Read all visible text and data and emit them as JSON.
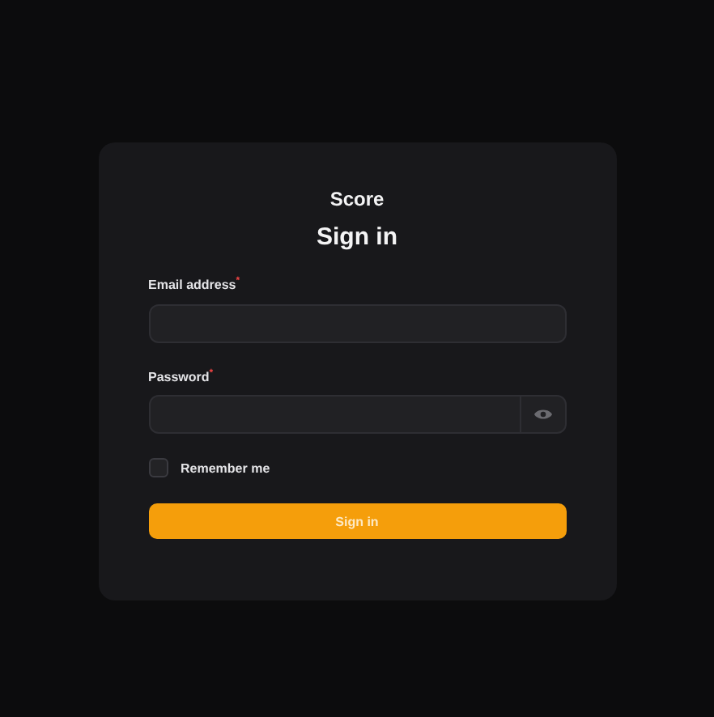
{
  "brand": "Score",
  "heading": "Sign in",
  "fields": [
    {
      "label": "Email address$^{*}$",
      "kind": "text"
    },
    {
      "label": "Password$^{*}$",
      "kind": "password"
    }
  ],
  "remember": {
    "label": "Remember me",
    "checked": false
  },
  "submit": "Sign in"
}
